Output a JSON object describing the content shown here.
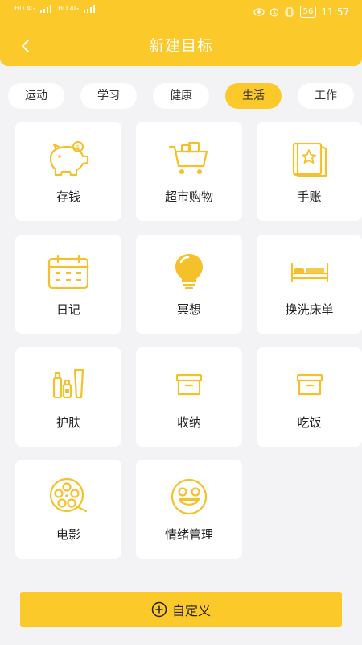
{
  "status_bar": {
    "left": [
      "HD 4G",
      "HD 4G"
    ],
    "battery": "56",
    "time": "11:57"
  },
  "header": {
    "title": "新建目标",
    "back_icon": "chevron-left-icon"
  },
  "tabs": [
    {
      "label": "运动",
      "active": false
    },
    {
      "label": "学习",
      "active": false
    },
    {
      "label": "健康",
      "active": false
    },
    {
      "label": "生活",
      "active": true
    },
    {
      "label": "工作",
      "active": false
    }
  ],
  "items": [
    {
      "label": "存钱",
      "icon": "piggy-bank-icon"
    },
    {
      "label": "超市购物",
      "icon": "shopping-cart-icon"
    },
    {
      "label": "手账",
      "icon": "notebook-icon"
    },
    {
      "label": "日记",
      "icon": "calendar-icon"
    },
    {
      "label": "冥想",
      "icon": "lightbulb-icon"
    },
    {
      "label": "换洗床单",
      "icon": "bed-icon"
    },
    {
      "label": "护肤",
      "icon": "skincare-bottles-icon"
    },
    {
      "label": "收纳",
      "icon": "storage-box-icon"
    },
    {
      "label": "吃饭",
      "icon": "storage-box-icon"
    },
    {
      "label": "电影",
      "icon": "film-reel-icon"
    },
    {
      "label": "情绪管理",
      "icon": "smiley-face-icon"
    }
  ],
  "custom_button": {
    "label": "自定义",
    "icon": "plus-circle-icon"
  },
  "colors": {
    "accent": "#fbc92a",
    "background": "#f3f3f5",
    "card": "#ffffff"
  }
}
